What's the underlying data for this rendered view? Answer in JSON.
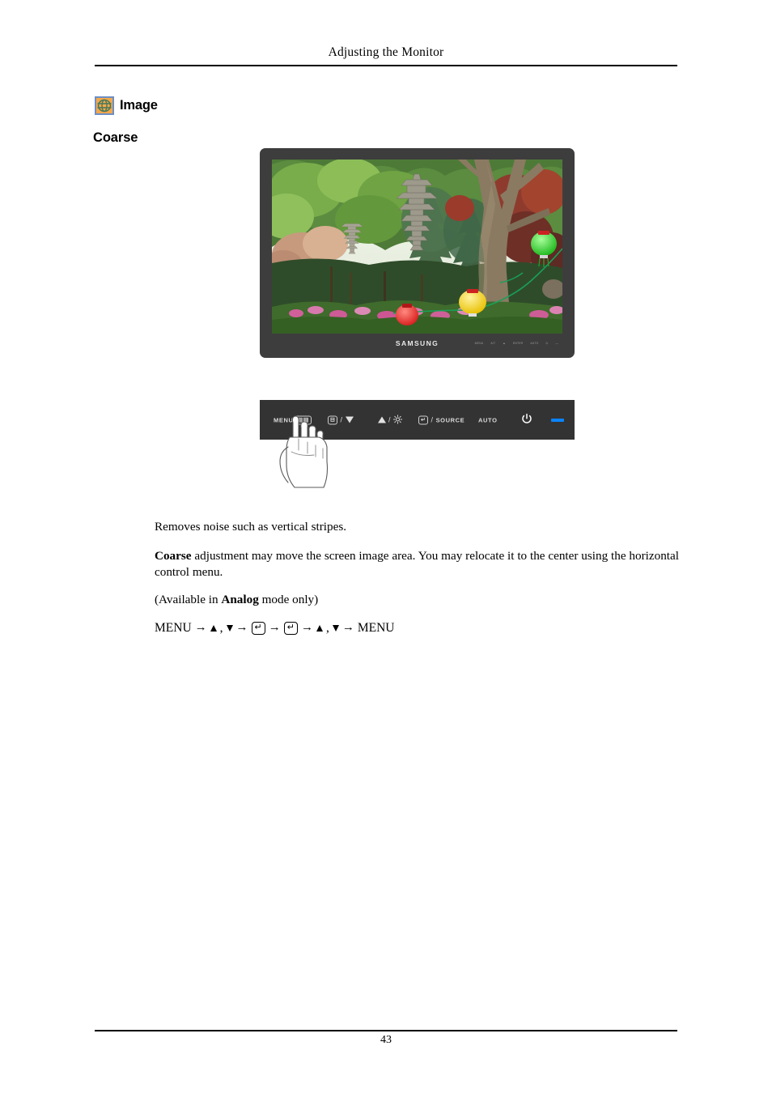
{
  "page": {
    "header_title": "Adjusting the Monitor",
    "page_number": "43"
  },
  "section": {
    "icon_name": "image-globe-icon",
    "icon_bg_color": "#f5a84b",
    "icon_border_color": "#6d8fc4",
    "title": "Image",
    "subtitle": "Coarse"
  },
  "monitor": {
    "brand": "SAMSUNG",
    "screen_alt": "Korean garden photograph with stone pagodas, green trees, red foliage and hanging paper lanterns",
    "bezel_color": "#3d3d3d",
    "chin_buttons": [
      "MENU",
      "A/T",
      "▲",
      "ENTER",
      "AUTO",
      "⏻",
      "—"
    ]
  },
  "control_panel": {
    "background_color": "#333333",
    "led_color": "#0a84ff",
    "buttons": [
      {
        "name": "menu-button",
        "label": "MENU",
        "glyph": "keybox"
      },
      {
        "name": "down-button",
        "label": "",
        "glyph": "keybox-slash-down",
        "separator": "/"
      },
      {
        "name": "up-brightness-button",
        "label": "",
        "glyph": "up-slash-sun",
        "separator": "/"
      },
      {
        "name": "enter-source-button",
        "label": "SOURCE",
        "glyph": "keybox",
        "separator": "/"
      },
      {
        "name": "auto-button",
        "label": "AUTO",
        "glyph": "text"
      },
      {
        "name": "power-button",
        "label": "",
        "glyph": "power"
      },
      {
        "name": "power-led",
        "label": "",
        "glyph": "led"
      }
    ],
    "hand_illustration": "hand-pressing-menu-button"
  },
  "content": {
    "paragraph_1": "Removes noise such as vertical stripes.",
    "paragraph_2_bold": "Coarse",
    "paragraph_2_rest": " adjustment may move the screen image area. You may relocate it to the center using the horizontal control menu.",
    "paragraph_3_pre": "(Available in ",
    "paragraph_3_bold": "Analog",
    "paragraph_3_post": " mode only)",
    "menu_sequence": {
      "start": "MENU",
      "end": "MENU",
      "arrow": "→",
      "comma": ",",
      "enter_glyph": "↵"
    }
  }
}
